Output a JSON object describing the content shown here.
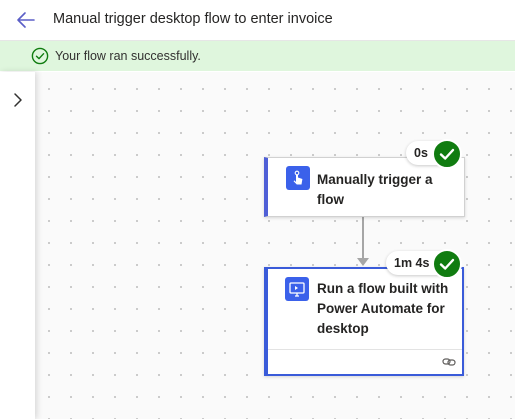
{
  "header": {
    "title": "Manual trigger desktop flow to enter invoice"
  },
  "banner": {
    "message": "Your flow ran successfully."
  },
  "colors": {
    "accent": "#3b61ea",
    "success": "#107c10",
    "banner_bg": "#dff6dd"
  },
  "icons": {
    "back": "arrow-left-icon",
    "banner": "check-circle-icon",
    "sidebar": "chevron-right-icon",
    "step1": "touch-icon",
    "step2": "desktop-flow-icon",
    "status": "checkmark-icon",
    "link": "link-icon"
  },
  "steps": [
    {
      "label": "Manually trigger a\nflow",
      "duration": "0s",
      "status": "succeeded"
    },
    {
      "label": "Run a flow built with\nPower Automate for\ndesktop",
      "duration": "1m 4s",
      "status": "succeeded"
    }
  ]
}
